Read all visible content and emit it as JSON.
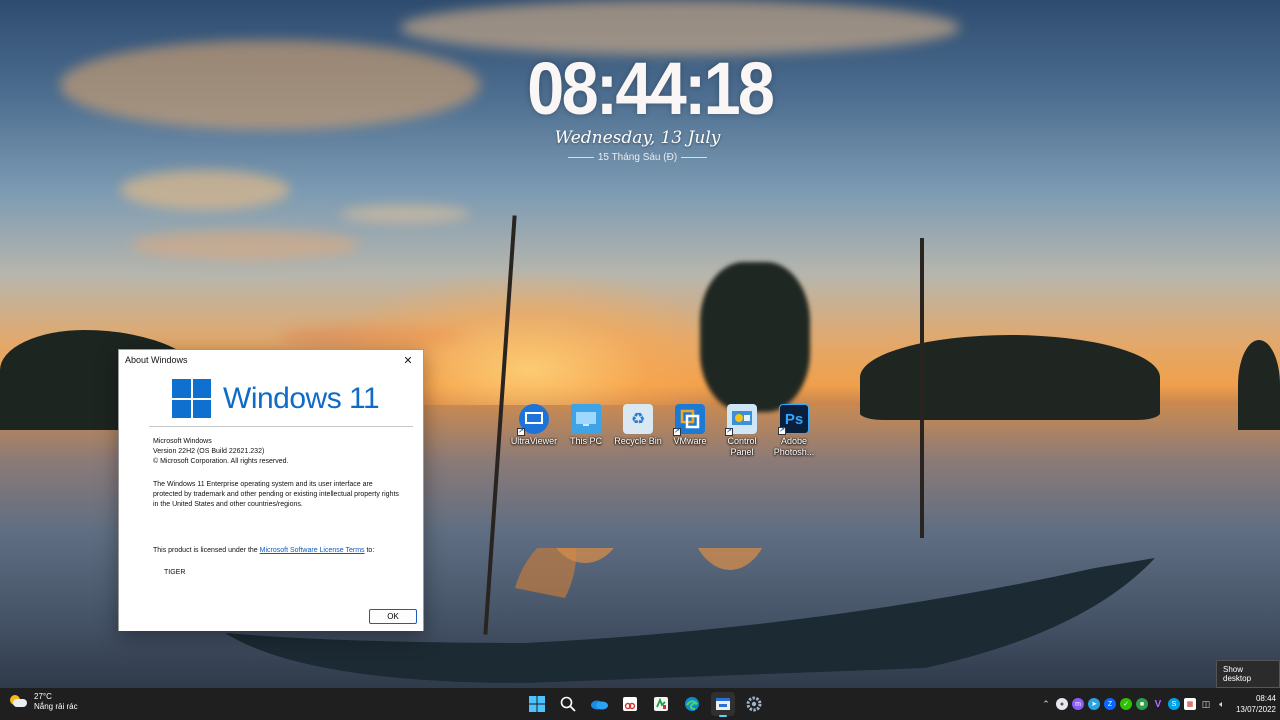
{
  "desktop": {
    "clock": {
      "time": "08:44:18",
      "date": "Wednesday, 13 July",
      "lunar": "15 Tháng Sáu (Đ)"
    },
    "icons": [
      {
        "label": "UltraViewer",
        "icon": "ultraviewer-icon",
        "color": "#1e73d8"
      },
      {
        "label": "This PC",
        "icon": "this-pc-icon",
        "color": "#3fa3e8"
      },
      {
        "label": "Recycle Bin",
        "icon": "recycle-bin-icon",
        "color": "#d9e8f2"
      },
      {
        "label": "VMware",
        "icon": "vmware-icon",
        "color": "#1c7ad4"
      },
      {
        "label": "Control Panel",
        "icon": "control-panel-icon",
        "color": "#3f8fd6"
      },
      {
        "label": "Adobe Photosh...",
        "icon": "photoshop-icon",
        "color": "#0a1f3c",
        "glyph": "Ps"
      }
    ]
  },
  "about_dialog": {
    "title": "About Windows",
    "logo_text": "Windows 11",
    "product": "Microsoft Windows",
    "version": "Version 22H2 (OS Build 22621.232)",
    "copyright": "© Microsoft Corporation. All rights reserved.",
    "description": "The Windows 11 Enterprise operating system and its user interface are protected by trademark and other pending or existing intellectual property rights in the United States and other countries/regions.",
    "license_prefix": "This product is licensed under the ",
    "license_link": "Microsoft Software License Terms",
    "license_suffix": " to:",
    "licensee": "TIGER",
    "ok_label": "OK"
  },
  "tooltip": {
    "text": "Show desktop"
  },
  "taskbar": {
    "weather": {
      "temp": "27°C",
      "condition": "Nắng rải rác"
    },
    "pinned": [
      {
        "icon": "windows-start-icon",
        "active": false
      },
      {
        "icon": "search-icon",
        "active": false
      },
      {
        "icon": "onedrive-icon",
        "active": false
      },
      {
        "icon": "snipping-tool-icon",
        "active": false
      },
      {
        "icon": "app-icon",
        "active": false
      },
      {
        "icon": "edge-icon",
        "active": false
      },
      {
        "icon": "about-windows-icon",
        "active": true
      },
      {
        "icon": "settings-icon",
        "active": false
      }
    ],
    "tray_icons": [
      "chevron-up-icon",
      "chat-icon",
      "messenger-icon",
      "telegram-icon",
      "zalo-icon",
      "wechat-icon",
      "green-app-icon",
      "vivaldi-icon",
      "skype-icon",
      "calendar-icon",
      "network-icon",
      "volume-icon"
    ],
    "time": "08:44",
    "date": "13/07/2022"
  }
}
